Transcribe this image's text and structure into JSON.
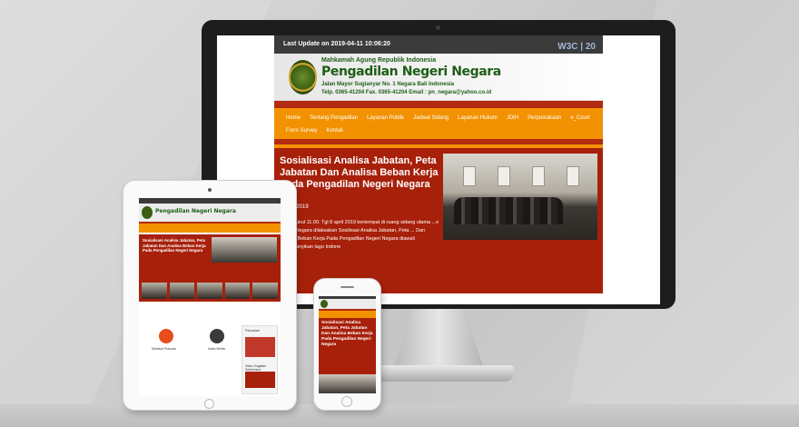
{
  "desktop": {
    "topbar": {
      "last_update": "Last Update on 2019-04-11 10:06:20",
      "badge": "W3C | 20"
    },
    "banner": {
      "org": "Mahkamah Agung Republik Indonesia",
      "court_name": "Pengadilan Negeri Negara",
      "address": "Jalan Mayor Sugianyar No. 1 Negara Bali Indonesia",
      "contact": "Telp. 0365-41204 Fax. 0365-41204 Email : pn_negara@yahoo.co.id"
    },
    "menu": [
      "Home",
      "Tentang Pengadilan",
      "Layanan Publik",
      "Jadwal Sidang",
      "Layanan Hukum",
      "JDIH",
      "Perpustakaan",
      "e_Court",
      "Form Survey",
      "Kontak"
    ],
    "hero": {
      "title": "Sosialisasi Analisa Jabatan, Peta Jabatan Dan Analisa Beban Kerja Pada Pengadilan Negeri Negara",
      "date": "8 April 2019",
      "text": "...min pukul 11.00. Tgl 8 april 2019 bertempat di ruang sidang utama ...n Negeri Negara dilaksakan Sosilisasi Analisa Jabatan, Peta ... Dan Analisa Beban Kerja Pada Pengadilan Negeri Negara diawali ...menyanyikan lagu Indone",
      "button": "..."
    }
  },
  "tablet": {
    "court_name": "Pengadilan Negeri Negara",
    "hero_title": "Sosialisasi Analisa Jabatan, Peta Jabatan Dan Analisa Beban Kerja Pada Pengadilan Negeri Negara",
    "widgets": [
      "Direktori Putusan",
      "Index Berita"
    ],
    "side_title": "Pencarian",
    "side_video": "Video Gugatan Sederhana"
  },
  "phone": {
    "hero_title": "Sosialisasi Analisa Jabatan, Peta Jabatan Dan Analisa Beban Kerja Pada Pengadilan Negeri Negara"
  },
  "colors": {
    "menu_orange": "#f29200",
    "hero_red": "#a7200a",
    "accent_red": "#b22a10",
    "court_green": "#1d5e16"
  }
}
